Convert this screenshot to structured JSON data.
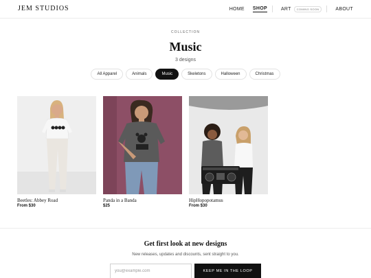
{
  "brand": {
    "name": "JEM STUDIOS"
  },
  "nav": {
    "home": "HOME",
    "shop": "SHOP",
    "art": "ART",
    "art_badge": "COMING SOON",
    "about": "ABOUT"
  },
  "collection": {
    "eyebrow": "COLLECTION",
    "title": "Music",
    "count": "3 designs"
  },
  "filters": [
    {
      "label": "All Apparel",
      "active": false
    },
    {
      "label": "Animals",
      "active": false
    },
    {
      "label": "Music",
      "active": true
    },
    {
      "label": "Skeletons",
      "active": false
    },
    {
      "label": "Halloween",
      "active": false
    },
    {
      "label": "Christmas",
      "active": false
    }
  ],
  "products": [
    {
      "name": "Beetles: Abbey Road",
      "price": "From $30"
    },
    {
      "name": "Panda in a Banda",
      "price": "$25"
    },
    {
      "name": "HipHopopotamus",
      "price": "From $30"
    }
  ],
  "newsletter": {
    "heading": "Get first look at new designs",
    "subtext": "New releases, updates and discounts, sent straight to you.",
    "placeholder": "you@example.com",
    "button": "KEEP ME IN THE LOOP"
  },
  "colors": {
    "accent": "#111111",
    "background": "#ffffff",
    "photo_bg_1": "#eeeeee",
    "photo_bg_2": "#8d4f66",
    "photo_bg_3": "#e9e9e9"
  }
}
